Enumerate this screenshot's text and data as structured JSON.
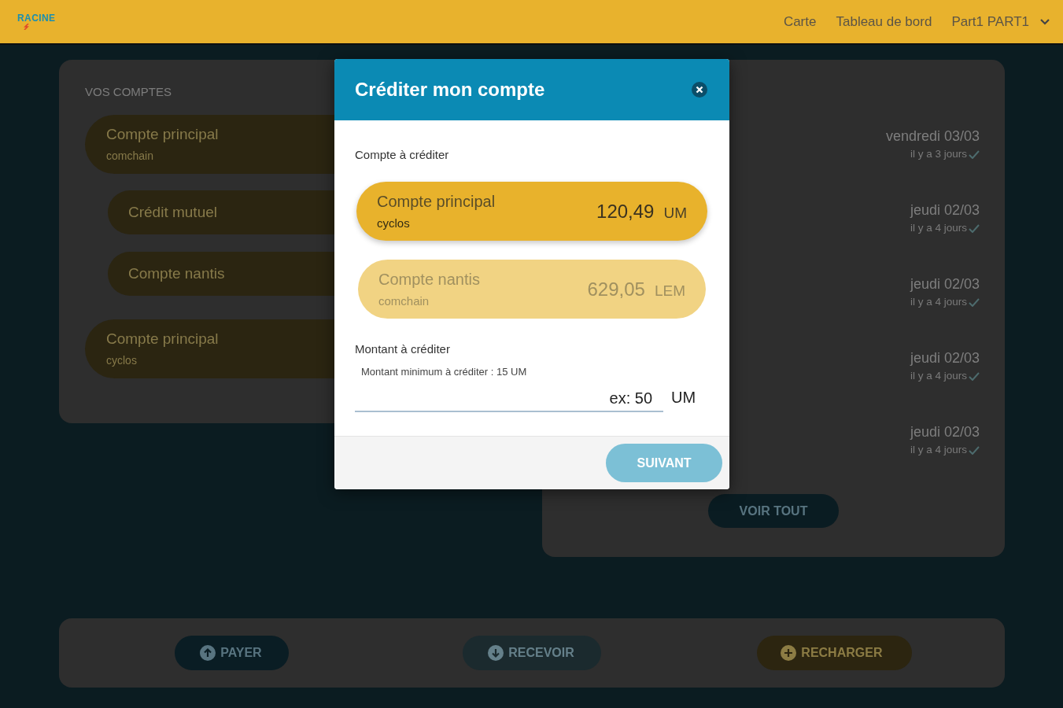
{
  "header": {
    "logo": "RACINE",
    "nav": [
      {
        "label": "Carte"
      },
      {
        "label": "Tableau de bord"
      }
    ],
    "user_menu": {
      "label": "Part1 PART1"
    }
  },
  "accounts_panel": {
    "title": "VOS COMPTES",
    "accounts": [
      {
        "name": "Compte principal",
        "network": "comchain",
        "children": [
          {
            "name": "Crédit mutuel"
          },
          {
            "name": "Compte nantis"
          }
        ]
      },
      {
        "name": "Compte principal",
        "network": "cyclos"
      }
    ]
  },
  "transactions_panel": {
    "items": [
      {
        "date": "vendredi 03/03",
        "relative": "il y a 3 jours",
        "confirmed": true
      },
      {
        "date": "jeudi 02/03",
        "relative": "il y a 4 jours",
        "confirmed": true
      },
      {
        "date": "jeudi 02/03",
        "relative": "il y a 4 jours",
        "confirmed": true
      },
      {
        "date": "jeudi 02/03",
        "relative": "il y a 4 jours",
        "confirmed": true
      },
      {
        "date": "jeudi 02/03",
        "relative": "il y a 4 jours",
        "confirmed": true
      }
    ],
    "view_all_button": "VOIR TOUT"
  },
  "action_bar": {
    "buttons": [
      {
        "label": "PAYER",
        "kind": "pay"
      },
      {
        "label": "RECEVOIR",
        "kind": "receive"
      },
      {
        "label": "RECHARGER",
        "kind": "recharge"
      }
    ]
  },
  "dialog": {
    "title": "Créditer mon compte",
    "account_label": "Compte à créditer",
    "accounts": [
      {
        "name": "Compte principal",
        "network": "cyclos",
        "balance": "120,49",
        "currency": "UM",
        "selected": true
      },
      {
        "name": "Compte nantis",
        "network": "comchain",
        "balance": "629,05",
        "currency": "LEM",
        "selected": false
      }
    ],
    "amount_label": "Montant à créditer",
    "amount_hint": "Montant minimum à créditer : 15 UM",
    "amount_field": {
      "placeholder": "ex: 50",
      "unit": "UM"
    },
    "next_button": {
      "label": "SUIVANT",
      "disabled": true
    }
  }
}
